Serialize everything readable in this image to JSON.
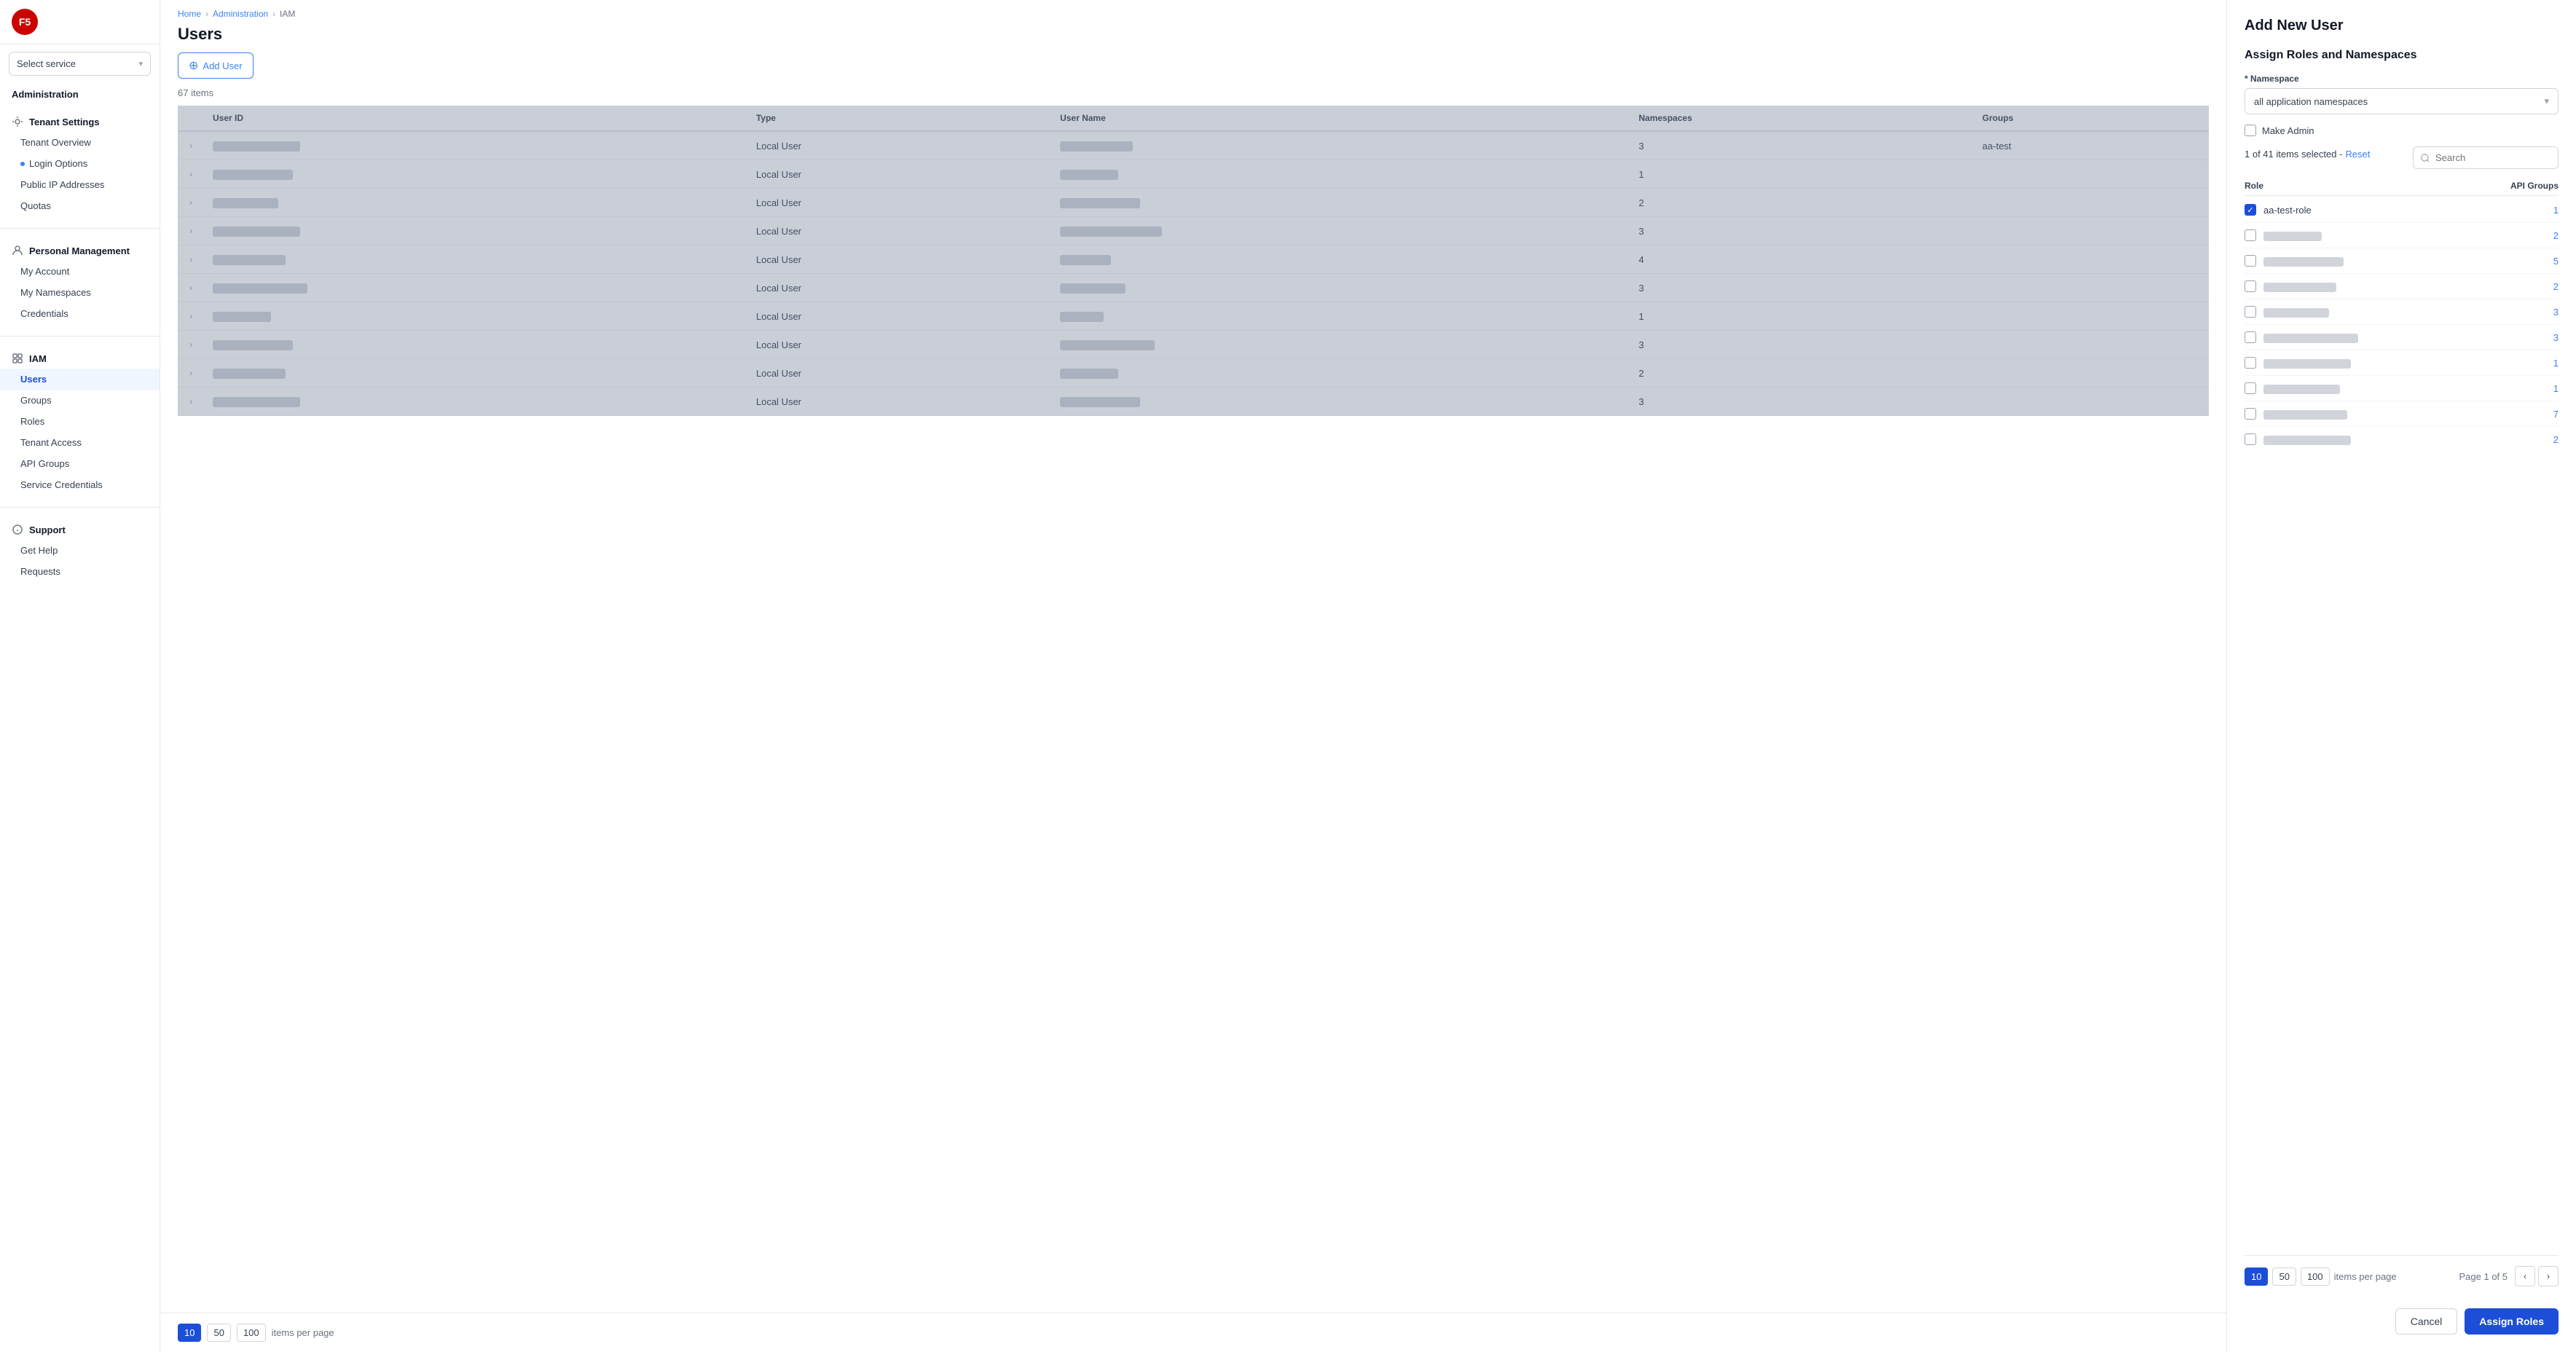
{
  "app": {
    "logo": "F5"
  },
  "sidebar": {
    "select_service_label": "Select service",
    "administration_label": "Administration",
    "sections": [
      {
        "title": "Tenant Settings",
        "icon": "settings-icon",
        "items": [
          {
            "label": "Tenant Overview",
            "active": false
          },
          {
            "label": "Login Options",
            "active": false,
            "dot": true
          },
          {
            "label": "Public IP Addresses",
            "active": false
          },
          {
            "label": "Quotas",
            "active": false
          }
        ]
      },
      {
        "title": "Personal Management",
        "icon": "user-icon",
        "items": [
          {
            "label": "My Account",
            "active": false
          },
          {
            "label": "My Namespaces",
            "active": false
          },
          {
            "label": "Credentials",
            "active": false
          }
        ]
      },
      {
        "title": "IAM",
        "icon": "iam-icon",
        "items": [
          {
            "label": "Users",
            "active": true
          },
          {
            "label": "Groups",
            "active": false
          },
          {
            "label": "Roles",
            "active": false
          },
          {
            "label": "Tenant Access",
            "active": false
          },
          {
            "label": "API Groups",
            "active": false
          },
          {
            "label": "Service Credentials",
            "active": false
          }
        ]
      },
      {
        "title": "Support",
        "icon": "support-icon",
        "items": [
          {
            "label": "Get Help",
            "active": false
          },
          {
            "label": "Requests",
            "active": false
          }
        ]
      }
    ]
  },
  "breadcrumb": {
    "items": [
      "Home",
      "Administration",
      "IAM"
    ]
  },
  "page": {
    "title": "Users",
    "add_user_label": "Add User",
    "item_count": "67 items"
  },
  "table": {
    "columns": [
      "",
      "User ID",
      "Type",
      "User Name",
      "Namespaces",
      "Groups"
    ],
    "rows": [
      {
        "type": "Local User",
        "namespaces": "3",
        "groups": "aa-test",
        "uid_w": 120,
        "name_w": 100
      },
      {
        "type": "Local User",
        "namespaces": "1",
        "groups": "",
        "uid_w": 110,
        "name_w": 80
      },
      {
        "type": "Local User",
        "namespaces": "2",
        "groups": "",
        "uid_w": 90,
        "name_w": 110
      },
      {
        "type": "Local User",
        "namespaces": "3",
        "groups": "",
        "uid_w": 120,
        "name_w": 140
      },
      {
        "type": "Local User",
        "namespaces": "4",
        "groups": "",
        "uid_w": 100,
        "name_w": 70
      },
      {
        "type": "Local User",
        "namespaces": "3",
        "groups": "",
        "uid_w": 130,
        "name_w": 90
      },
      {
        "type": "Local User",
        "namespaces": "1",
        "groups": "",
        "uid_w": 80,
        "name_w": 60
      },
      {
        "type": "Local User",
        "namespaces": "3",
        "groups": "",
        "uid_w": 110,
        "name_w": 130
      },
      {
        "type": "Local User",
        "namespaces": "2",
        "groups": "",
        "uid_w": 100,
        "name_w": 80
      },
      {
        "type": "Local User",
        "namespaces": "3",
        "groups": "",
        "uid_w": 120,
        "name_w": 110
      }
    ]
  },
  "pagination": {
    "sizes": [
      "10",
      "50",
      "100"
    ],
    "active_size": "10",
    "items_per_page_label": "items per page"
  },
  "panel": {
    "title": "Add New User",
    "subtitle": "Assign Roles and Namespaces",
    "namespace_label": "* Namespace",
    "namespace_value": "all application namespaces",
    "make_admin_label": "Make Admin",
    "selection_info": "1 of 41 items selected -",
    "reset_label": "Reset",
    "search_placeholder": "Search",
    "roles_col": "Role",
    "api_groups_col": "API Groups",
    "roles": [
      {
        "name": "aa-test-role",
        "api_count": "1",
        "checked": true,
        "blurred": false,
        "name_w": 0
      },
      {
        "name": "",
        "api_count": "2",
        "checked": false,
        "blurred": true,
        "name_w": 80
      },
      {
        "name": "",
        "api_count": "5",
        "checked": false,
        "blurred": true,
        "name_w": 110
      },
      {
        "name": "",
        "api_count": "2",
        "checked": false,
        "blurred": true,
        "name_w": 100
      },
      {
        "name": "",
        "api_count": "3",
        "checked": false,
        "blurred": true,
        "name_w": 90
      },
      {
        "name": "",
        "api_count": "3",
        "checked": false,
        "blurred": true,
        "name_w": 130
      },
      {
        "name": "",
        "api_count": "1",
        "checked": false,
        "blurred": true,
        "name_w": 120
      },
      {
        "name": "",
        "api_count": "1",
        "checked": false,
        "blurred": true,
        "name_w": 105
      },
      {
        "name": "",
        "api_count": "7",
        "checked": false,
        "blurred": true,
        "name_w": 115
      },
      {
        "name": "",
        "api_count": "2",
        "checked": false,
        "blurred": true,
        "name_w": 120
      }
    ],
    "pagination": {
      "sizes": [
        "10",
        "50",
        "100"
      ],
      "active_size": "10",
      "items_per_page_label": "items per page",
      "page_info": "Page 1 of 5"
    },
    "cancel_label": "Cancel",
    "assign_label": "Assign Roles"
  }
}
